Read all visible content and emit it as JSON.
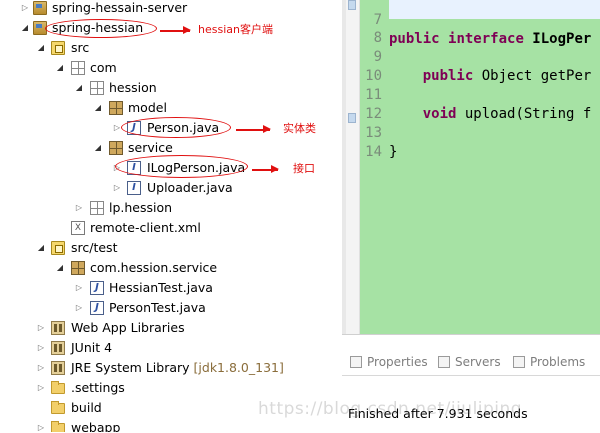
{
  "tree": {
    "items": [
      {
        "label": "spring-hessain-server",
        "icon": "project-icon",
        "expanded": false
      },
      {
        "label": "spring-hessian",
        "icon": "project-icon",
        "expanded": true
      },
      {
        "label": "src",
        "icon": "source-folder-icon",
        "expanded": true
      },
      {
        "label": "com",
        "icon": "package-icon",
        "expanded": true
      },
      {
        "label": "hession",
        "icon": "package-icon",
        "expanded": true
      },
      {
        "label": "model",
        "icon": "package-icon",
        "expanded": true
      },
      {
        "label": "Person.java",
        "icon": "java-class-icon",
        "expanded": false
      },
      {
        "label": "service",
        "icon": "package-icon",
        "expanded": true
      },
      {
        "label": "ILogPerson.java",
        "icon": "java-interface-icon",
        "expanded": false
      },
      {
        "label": "Uploader.java",
        "icon": "java-interface-icon",
        "expanded": false
      },
      {
        "label": "lp.hession",
        "icon": "package-icon",
        "expanded": false
      },
      {
        "label": "remote-client.xml",
        "icon": "xml-file-icon",
        "expanded": false
      },
      {
        "label": "src/test",
        "icon": "source-folder-icon",
        "expanded": true
      },
      {
        "label": "com.hession.service",
        "icon": "package-icon",
        "expanded": true
      },
      {
        "label": "HessianTest.java",
        "icon": "java-class-icon",
        "expanded": false
      },
      {
        "label": "PersonTest.java",
        "icon": "java-class-icon",
        "expanded": false
      },
      {
        "label": "Web App Libraries",
        "icon": "library-icon",
        "expanded": false
      },
      {
        "label": "JUnit 4",
        "icon": "library-icon",
        "expanded": false
      },
      {
        "label": "JRE System Library",
        "decoration": "[jdk1.8.0_131]",
        "icon": "library-icon",
        "expanded": false
      },
      {
        "label": ".settings",
        "icon": "folder-icon",
        "expanded": false
      },
      {
        "label": "build",
        "icon": "folder-icon",
        "expanded": false
      },
      {
        "label": "webapp",
        "icon": "folder-icon",
        "expanded": false
      }
    ]
  },
  "annotations": {
    "client": "hessian客户端",
    "entity": "实体类",
    "interface": "接口",
    "color": "#e01010"
  },
  "editor": {
    "background": "#a6e2a4",
    "lines": [
      {
        "num": "7",
        "code": "public interface ILogPer"
      },
      {
        "num": "8",
        "code": ""
      },
      {
        "num": "9",
        "code": "    public Object getPer"
      },
      {
        "num": "10",
        "code": ""
      },
      {
        "num": "11",
        "code": "    void upload(String f"
      },
      {
        "num": "12",
        "code": ""
      },
      {
        "num": "13",
        "code": "}"
      },
      {
        "num": "14",
        "code": ""
      }
    ]
  },
  "bottom": {
    "tabs": [
      "Properties",
      "Servers",
      "Problems"
    ],
    "status": "Finished after 7.931 seconds"
  },
  "watermark": "https://blog.csdn.net/jiuliping"
}
